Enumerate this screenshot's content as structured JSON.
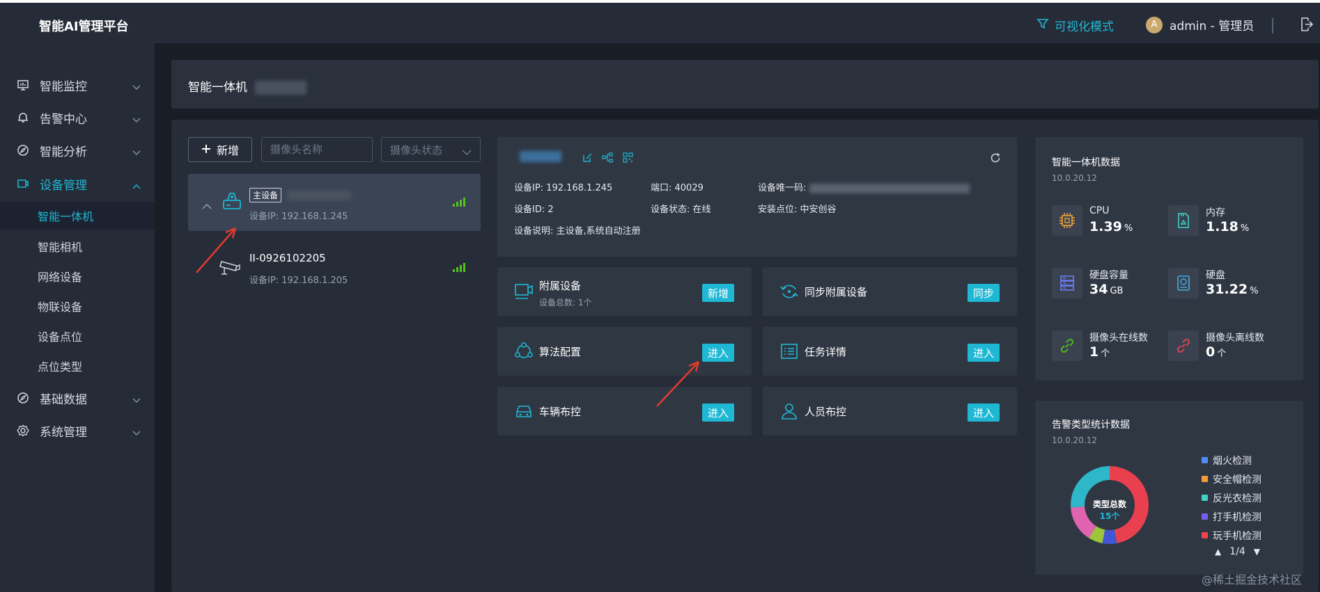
{
  "header": {
    "app_title": "智能AI管理平台",
    "viz_mode_label": "可视化模式",
    "avatar_letter": "A",
    "user_label": "admin - 管理员"
  },
  "sidebar": {
    "items": [
      {
        "label": "智能监控",
        "icon": "monitor-icon"
      },
      {
        "label": "告警中心",
        "icon": "bell-icon"
      },
      {
        "label": "智能分析",
        "icon": "compass-icon"
      },
      {
        "label": "设备管理",
        "icon": "device-icon",
        "active": true
      },
      {
        "label": "基础数据",
        "icon": "compass-icon"
      },
      {
        "label": "系统管理",
        "icon": "gear-icon"
      }
    ],
    "sub_items": [
      "智能一体机",
      "智能相机",
      "网络设备",
      "物联设备",
      "设备点位",
      "点位类型"
    ]
  },
  "page": {
    "title": "智能一体机"
  },
  "toolbar": {
    "add_label": "新增",
    "name_placeholder": "摄像头名称",
    "status_placeholder": "摄像头状态"
  },
  "devices": [
    {
      "tag": "主设备",
      "name": "",
      "ip": "设备IP:  192.168.1.245"
    },
    {
      "tag": "",
      "name": "II-0926102205",
      "ip": "设备IP:  192.168.1.205"
    }
  ],
  "device_info": {
    "ip": "设备IP:  192.168.1.245",
    "port": "端口:  40029",
    "uid_label": "设备唯一码:",
    "id": "设备ID:  2",
    "status": "设备状态:  在线",
    "location": "安装点位:  中安创谷",
    "description": "设备说明:  主设备,系统自动注册"
  },
  "tiles": [
    {
      "label": "附属设备",
      "sub": "设备总数:  1个",
      "button": "新增"
    },
    {
      "label": "同步附属设备",
      "button": "同步"
    },
    {
      "label": "算法配置",
      "button": "进入"
    },
    {
      "label": "任务详情",
      "button": "进入"
    },
    {
      "label": "车辆布控",
      "button": "进入"
    },
    {
      "label": "人员布控",
      "button": "进入"
    }
  ],
  "stats": {
    "title": "智能一体机数据",
    "subtitle": "10.0.20.12",
    "metrics": [
      {
        "label": "CPU",
        "value": "1.39",
        "unit": "%",
        "icon": "cpu-icon"
      },
      {
        "label": "内存",
        "value": "1.18",
        "unit": "%",
        "icon": "memory-card-icon"
      },
      {
        "label": "硬盘容量",
        "value": "34",
        "unit": "GB",
        "icon": "server-icon"
      },
      {
        "label": "硬盘",
        "value": "31.22",
        "unit": "%",
        "icon": "disk-icon"
      },
      {
        "label": "摄像头在线数",
        "value": "1",
        "unit": "个",
        "icon": "link-icon"
      },
      {
        "label": "摄像头离线数",
        "value": "0",
        "unit": "个",
        "icon": "broken-link-icon"
      }
    ]
  },
  "alarm": {
    "title": "告警类型统计数据",
    "subtitle": "10.0.20.12",
    "center_label": "类型总数",
    "center_value": "15个",
    "legend": [
      {
        "name": "烟火检测",
        "color": "#4e8cf7"
      },
      {
        "name": "安全帽检测",
        "color": "#f59a3b"
      },
      {
        "name": "反光衣检测",
        "color": "#3fd3c5"
      },
      {
        "name": "打手机检测",
        "color": "#7b5cf0"
      },
      {
        "name": "玩手机检测",
        "color": "#ec4452"
      }
    ],
    "pager": "1/4",
    "chart_data": {
      "type": "pie",
      "slices": [
        {
          "color": "#e8404e",
          "fraction": 0.47
        },
        {
          "color": "#4257d6",
          "fraction": 0.06
        },
        {
          "color": "#9cc53a",
          "fraction": 0.06
        },
        {
          "color": "#e063b0",
          "fraction": 0.15
        },
        {
          "color": "#2db7c9",
          "fraction": 0.26
        }
      ]
    }
  },
  "footer": {
    "watermark": "@稀土掘金技术社区"
  }
}
